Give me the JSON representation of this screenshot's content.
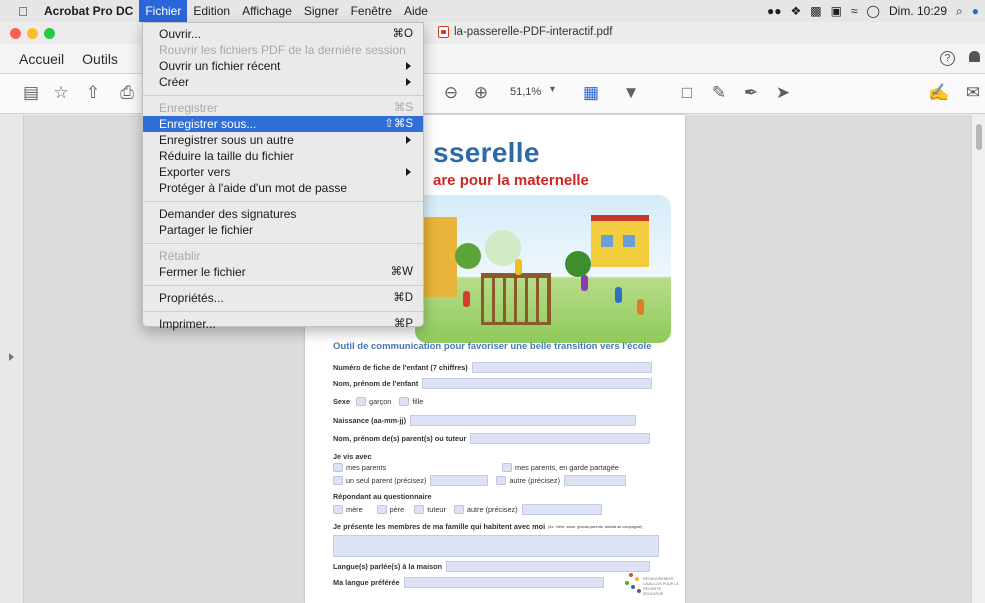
{
  "menubar": {
    "app_name": "Acrobat Pro DC",
    "menus": [
      "Fichier",
      "Edition",
      "Affichage",
      "Signer",
      "Fenêtre",
      "Aide"
    ],
    "active_menu": "Fichier",
    "clock": "Dim. 10:29"
  },
  "window": {
    "doc_title": "la-passerelle-PDF-interactif.pdf"
  },
  "tabs": [
    "Accueil",
    "Outils"
  ],
  "toolbar": {
    "zoom": "51,1%"
  },
  "fichier_menu": {
    "ouvrir": {
      "label": "Ouvrir...",
      "shortcut": "⌘O"
    },
    "rouvrir": {
      "label": "Rouvrir les fichiers PDF de la dernière session"
    },
    "ouvrir_recent": {
      "label": "Ouvrir un fichier récent"
    },
    "creer": {
      "label": "Créer"
    },
    "enregistrer": {
      "label": "Enregistrer",
      "shortcut": "⌘S"
    },
    "enregistrer_sous": {
      "label": "Enregistrer sous...",
      "shortcut": "⇧⌘S"
    },
    "enregistrer_autre": {
      "label": "Enregistrer sous un autre"
    },
    "reduire": {
      "label": "Réduire la taille du fichier"
    },
    "exporter": {
      "label": "Exporter vers"
    },
    "proteger": {
      "label": "Protéger à l'aide d'un mot de passe"
    },
    "demander_signatures": {
      "label": "Demander des signatures"
    },
    "partager": {
      "label": "Partager le fichier"
    },
    "retablir": {
      "label": "Rétablir"
    },
    "fermer": {
      "label": "Fermer le fichier",
      "shortcut": "⌘W"
    },
    "proprietes": {
      "label": "Propriétés...",
      "shortcut": "⌘D"
    },
    "imprimer": {
      "label": "Imprimer...",
      "shortcut": "⌘P"
    }
  },
  "pdf": {
    "title_part": "sserelle",
    "subtitle_part": "are pour la maternelle",
    "heading": "Outil de communication pour favoriser une belle transition vers l'école",
    "fields": {
      "numero": "Numéro de fiche de l'enfant (7 chiffres)",
      "nom": "Nom, prénom de l'enfant",
      "sexe": "Sexe",
      "garcon": "garçon",
      "fille": "fille",
      "naissance": "Naissance (aa-mm-jj)",
      "parents": "Nom, prénom de(s) parent(s) ou tuteur",
      "je_vis": "Je vis avec",
      "mes_parents": "mes parents",
      "garde": "mes parents, en garde partagée",
      "seul_parent": "un seul parent (précisez)",
      "autre1": "autre (précisez)",
      "repondant": "Répondant au questionnaire",
      "mere": "mère",
      "pere": "père",
      "tuteur": "tuteur",
      "autre2": "autre (précisez)",
      "membres": "Je présente les membres de ma famille qui habitent avec moi",
      "membres_note": "(ex.: frère, sœur, grands-parents, animal de compagnie)",
      "langues": "Langue(s) parlée(s) à la maison",
      "langue_pref": "Ma langue préférée",
      "logo_text": "REGROUPEMENT LAVALLOIS POUR LA RÉUSSITE ÉDUCATIVE"
    }
  },
  "colors": {
    "menu_highlight": "#2f6fd6",
    "menubar_active": "#2a66d9",
    "pdf_title_blue": "#2c6aa9",
    "pdf_subtitle_red": "#d0251e",
    "field_fill": "#dde2f4"
  }
}
